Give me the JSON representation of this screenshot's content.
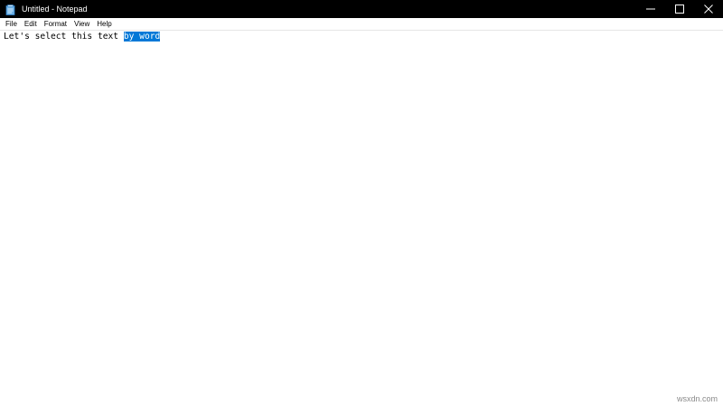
{
  "window": {
    "title": "Untitled - Notepad",
    "icon": "notepad-icon",
    "controls": {
      "minimize_label": "—",
      "maximize_icon": "maximize-icon",
      "close_icon": "close-icon"
    }
  },
  "menubar": {
    "items": [
      {
        "label": "File"
      },
      {
        "label": "Edit"
      },
      {
        "label": "Format"
      },
      {
        "label": "View"
      },
      {
        "label": "Help"
      }
    ]
  },
  "editor": {
    "text_before_selection": "Let's select this text ",
    "selected_text": "by word",
    "selection_color": "#0078d7"
  },
  "watermark": "wsxdn.com"
}
